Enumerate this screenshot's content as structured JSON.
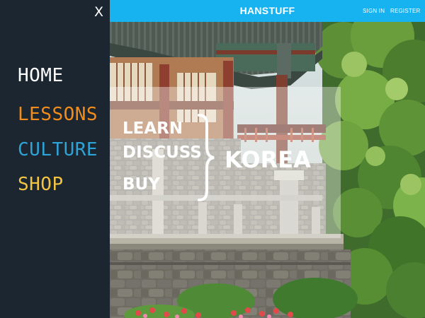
{
  "sidebar": {
    "close_label": "X",
    "items": [
      {
        "label": "HOME",
        "color": "#ffffff"
      },
      {
        "label": "LESSONS",
        "color": "#f28c1a"
      },
      {
        "label": "CULTURE",
        "color": "#2fa3d6"
      },
      {
        "label": "SHOP",
        "color": "#f3c443"
      }
    ],
    "background": "#1b2630"
  },
  "header": {
    "brand": "HANSTUFF",
    "sign_in": "SIGN IN",
    "register": "REGISTER",
    "background": "#17b3f0"
  },
  "hero": {
    "words": [
      "LEARN",
      "DISCUSS",
      "BUY"
    ],
    "brace_icon": "right-curly-brace",
    "target": "KOREA"
  }
}
